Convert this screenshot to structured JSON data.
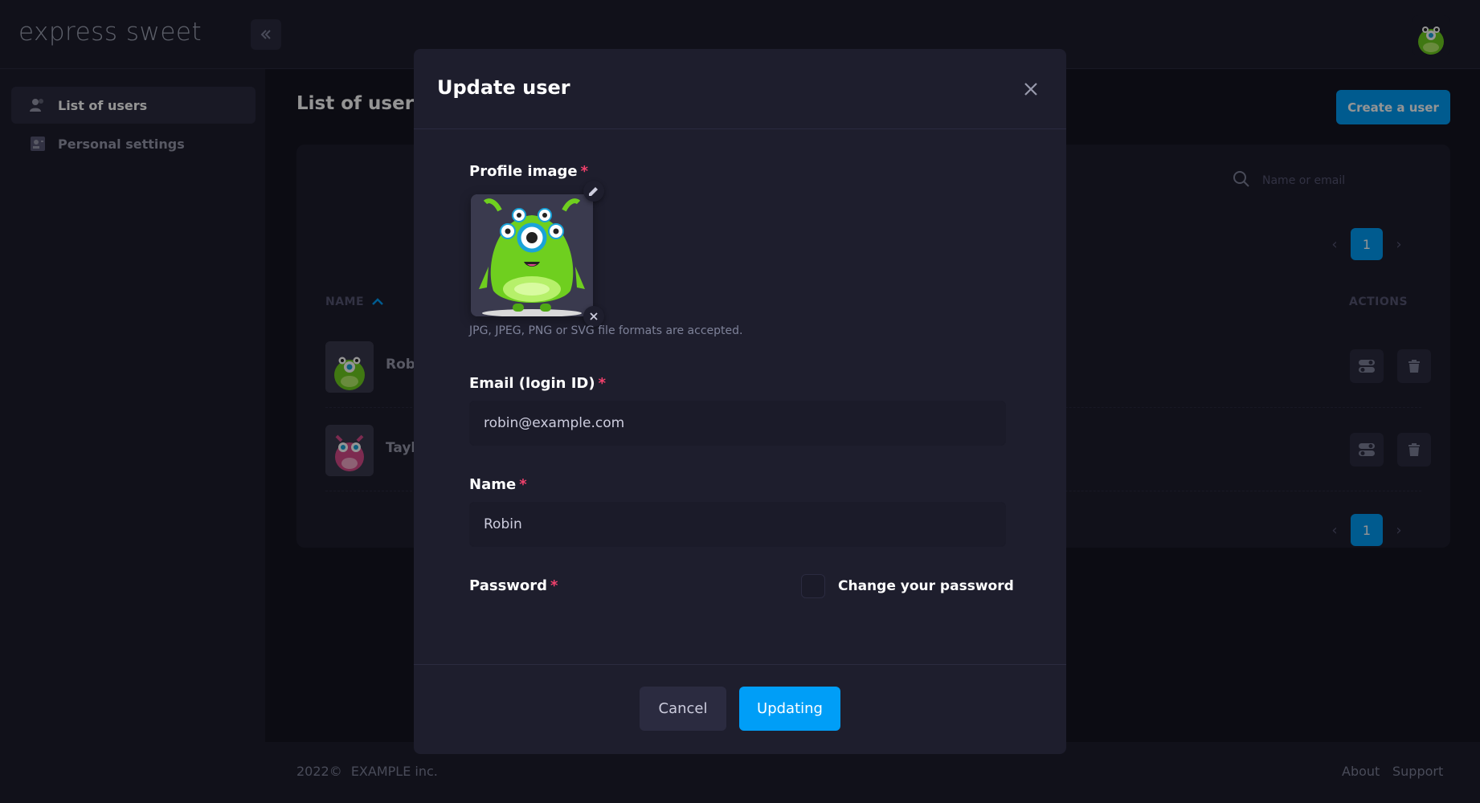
{
  "app": {
    "logo": "express sweet"
  },
  "sidebar": {
    "items": [
      {
        "label": "List of users",
        "icon": "users-icon",
        "active": true
      },
      {
        "label": "Personal settings",
        "icon": "id-card-icon",
        "active": false
      }
    ]
  },
  "main": {
    "title": "List of users",
    "create_button": "Create a user",
    "search": {
      "placeholder": "Name or email"
    },
    "pagination": {
      "current_page": "1"
    },
    "table": {
      "headers": {
        "name": "NAME",
        "actions": "ACTIONS"
      },
      "rows": [
        {
          "name": "Robi",
          "avatar": "green-monster"
        },
        {
          "name": "Tayl",
          "avatar": "pink-monster"
        }
      ]
    }
  },
  "footer": {
    "copyright": "2022©",
    "company": "EXAMPLE inc.",
    "links": [
      "About",
      "Support"
    ]
  },
  "modal": {
    "title": "Update user",
    "profile_image": {
      "label": "Profile image",
      "required_mark": "*",
      "hint": "JPG, JPEG, PNG or SVG file formats are accepted."
    },
    "email": {
      "label": "Email (login ID)",
      "required_mark": "*",
      "value": "robin@example.com"
    },
    "name": {
      "label": "Name",
      "required_mark": "*",
      "value": "Robin"
    },
    "password": {
      "label": "Password",
      "required_mark": "*",
      "change_label": "Change your password",
      "checked": false
    },
    "buttons": {
      "cancel": "Cancel",
      "submit": "Updating"
    }
  },
  "colors": {
    "primary": "#009ef7",
    "danger": "#f1416c",
    "surface": "#1e1e2d",
    "background": "#151521"
  }
}
